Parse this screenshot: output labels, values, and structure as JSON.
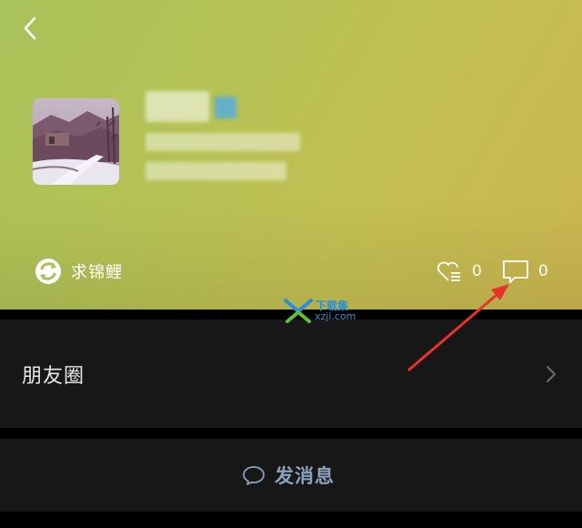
{
  "profile": {
    "status_text": "求锦鲤",
    "likes_count": "0",
    "comments_count": "0"
  },
  "watermark": {
    "line1": "下载集",
    "line2": "xzji.com"
  },
  "menu": {
    "moments_label": "朋友圈",
    "send_message_label": "发消息"
  },
  "colors": {
    "header_start": "#a9c25a",
    "header_end": "#cbb64f",
    "row_background": "#171717",
    "message_accent": "#8aa2be",
    "annotation_red": "#e8332a"
  },
  "icons": {
    "back": "chevron-left-icon",
    "status": "refresh-circle-icon",
    "like": "heart-list-icon",
    "comment": "comment-bubble-icon",
    "chevron": "chevron-right-icon",
    "message": "chat-bubble-icon"
  }
}
